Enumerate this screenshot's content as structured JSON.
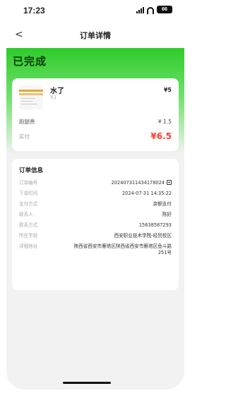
{
  "status_bar": {
    "time": "17:23",
    "battery": "66"
  },
  "nav": {
    "back_glyph": "<",
    "title": "订单详情"
  },
  "order_status": "已完成",
  "product": {
    "name": "水了",
    "qty": "X1",
    "price": "¥5"
  },
  "fees": {
    "delivery_label": "跑腿费",
    "delivery_value": "¥ 1.5",
    "paid_label": "实付",
    "paid_value": "¥6.5"
  },
  "order_info": {
    "title": "订单信息",
    "rows": [
      {
        "label": "订单编号",
        "value": "202407311434178024"
      },
      {
        "label": "下单时间",
        "value": "2024-07-31 14:35:22"
      },
      {
        "label": "支付方式",
        "value": "余额支付"
      },
      {
        "label": "联系人",
        "value": "陈好"
      },
      {
        "label": "联系方式",
        "value": "15638587293"
      },
      {
        "label": "所在学校",
        "value": "西安职业技术学院-经贸校区"
      },
      {
        "label": "详细地址",
        "value": "陕西省西安市雁塔区陕西省西安市雁塔区鱼斗路251号"
      }
    ]
  },
  "colors": {
    "accent_green": "#2ecc2a",
    "price_red": "#ff3b30"
  },
  "icons": [
    "signal-icon",
    "wifi-icon",
    "battery-icon",
    "back-icon",
    "copy-icon"
  ]
}
